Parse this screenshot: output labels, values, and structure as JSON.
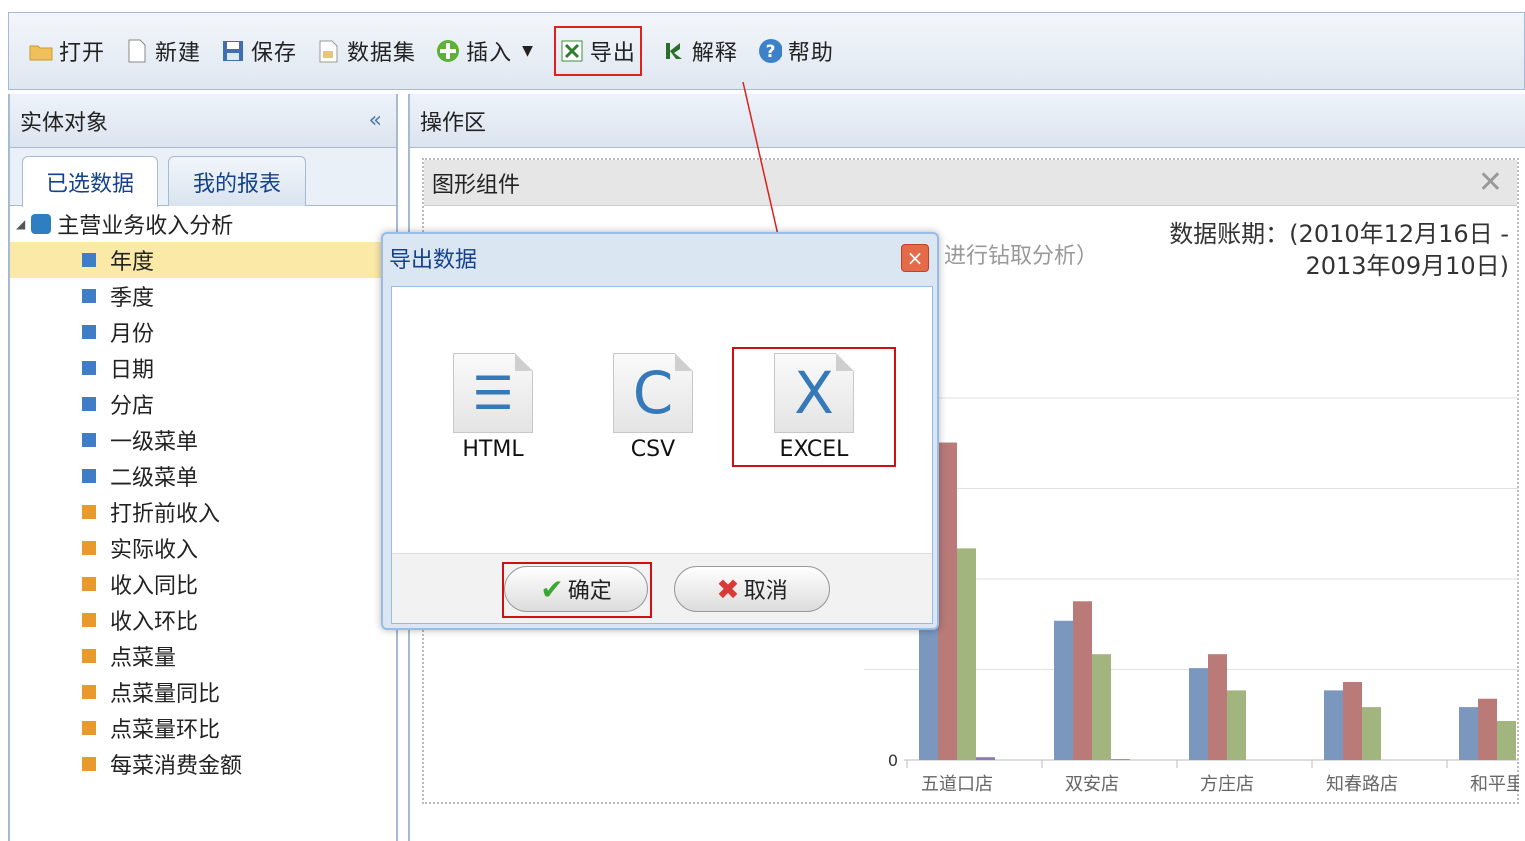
{
  "toolbar": {
    "open": "打开",
    "new": "新建",
    "save": "保存",
    "dataset": "数据集",
    "insert": "插入",
    "export": "导出",
    "explain": "解释",
    "help": "帮助"
  },
  "left": {
    "title": "实体对象",
    "collapse": "«",
    "tabs": [
      "已选数据",
      "我的报表"
    ],
    "root": "主营业务收入分析",
    "items": [
      {
        "label": "年度",
        "color": "#3f7ec6"
      },
      {
        "label": "季度",
        "color": "#3f7ec6"
      },
      {
        "label": "月份",
        "color": "#3f7ec6"
      },
      {
        "label": "日期",
        "color": "#3f7ec6"
      },
      {
        "label": "分店",
        "color": "#3f7ec6"
      },
      {
        "label": "一级菜单",
        "color": "#3f7ec6"
      },
      {
        "label": "二级菜单",
        "color": "#3f7ec6"
      },
      {
        "label": "打折前收入",
        "color": "#e89a2c"
      },
      {
        "label": "实际收入",
        "color": "#e89a2c"
      },
      {
        "label": "收入同比",
        "color": "#e89a2c"
      },
      {
        "label": "收入环比",
        "color": "#e89a2c"
      },
      {
        "label": "点菜量",
        "color": "#e89a2c"
      },
      {
        "label": "点菜量同比",
        "color": "#e89a2c"
      },
      {
        "label": "点菜量环比",
        "color": "#e89a2c"
      },
      {
        "label": "每菜消费金额",
        "color": "#e89a2c"
      }
    ]
  },
  "right": {
    "title": "操作区",
    "widget_title": "图形组件",
    "hint": "进行钻取分析）",
    "period_line1": "数据账期：(2010年12月16日 -",
    "period_line2": "2013年09月10日)"
  },
  "chart_data": {
    "type": "bar",
    "categories": [
      "五道口店",
      "双安店",
      "方庄店",
      "知春路店",
      "和平里"
    ],
    "series": [
      {
        "color": "#7b97bd",
        "values": [
          100,
          50,
          33,
          25,
          19
        ]
      },
      {
        "color": "#b97a78",
        "values": [
          114,
          57,
          38,
          28,
          22
        ]
      },
      {
        "color": "#a3b57e",
        "values": [
          76,
          38,
          25,
          19,
          14
        ]
      },
      {
        "color": "#8e7bb0",
        "values": [
          1,
          0.3,
          0,
          0,
          0
        ]
      }
    ],
    "y_tick": "0",
    "ylim": [
      0,
      130
    ]
  },
  "dialog": {
    "title": "导出数据",
    "close": "×",
    "options": [
      {
        "label": "HTML",
        "glyph": "☰"
      },
      {
        "label": "CSV",
        "glyph": "C"
      },
      {
        "label": "EXCEL",
        "glyph": "X"
      }
    ],
    "ok": "确定",
    "cancel": "取消"
  }
}
